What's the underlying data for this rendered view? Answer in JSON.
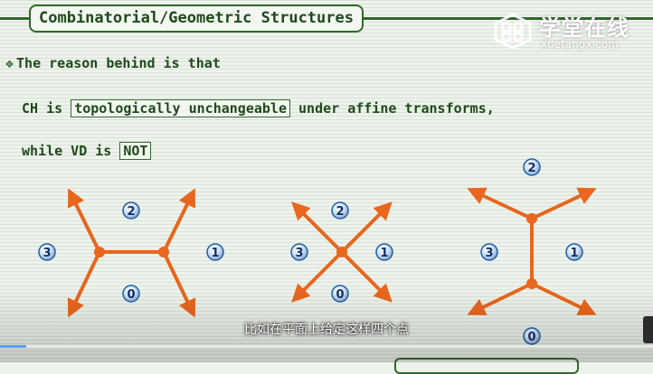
{
  "slide": {
    "title": "Combinatorial/Geometric Structures",
    "bullet_symbol": "❖",
    "line1": "The reason behind is that",
    "line2_prefix": "CH is ",
    "line2_boxed": "topologically unchangeable",
    "line2_suffix": " under affine transforms,",
    "line3_prefix": "while VD is ",
    "line3_boxed": "NOT"
  },
  "watermark": {
    "cn": "学堂在线",
    "en": "xuetangx.com"
  },
  "diagrams": [
    {
      "labels": [
        "2",
        "3",
        "1",
        "0"
      ]
    },
    {
      "labels": [
        "2",
        "3",
        "1",
        "0"
      ]
    },
    {
      "labels": [
        "2",
        "3",
        "1",
        "0"
      ]
    }
  ],
  "player": {
    "subtitle": "比如在平面上给定这样四个点",
    "progress": 0.04
  },
  "colors": {
    "accent": "#2f6b2a",
    "edge": "#e8661d",
    "label_fill": "#1f5fa8"
  }
}
